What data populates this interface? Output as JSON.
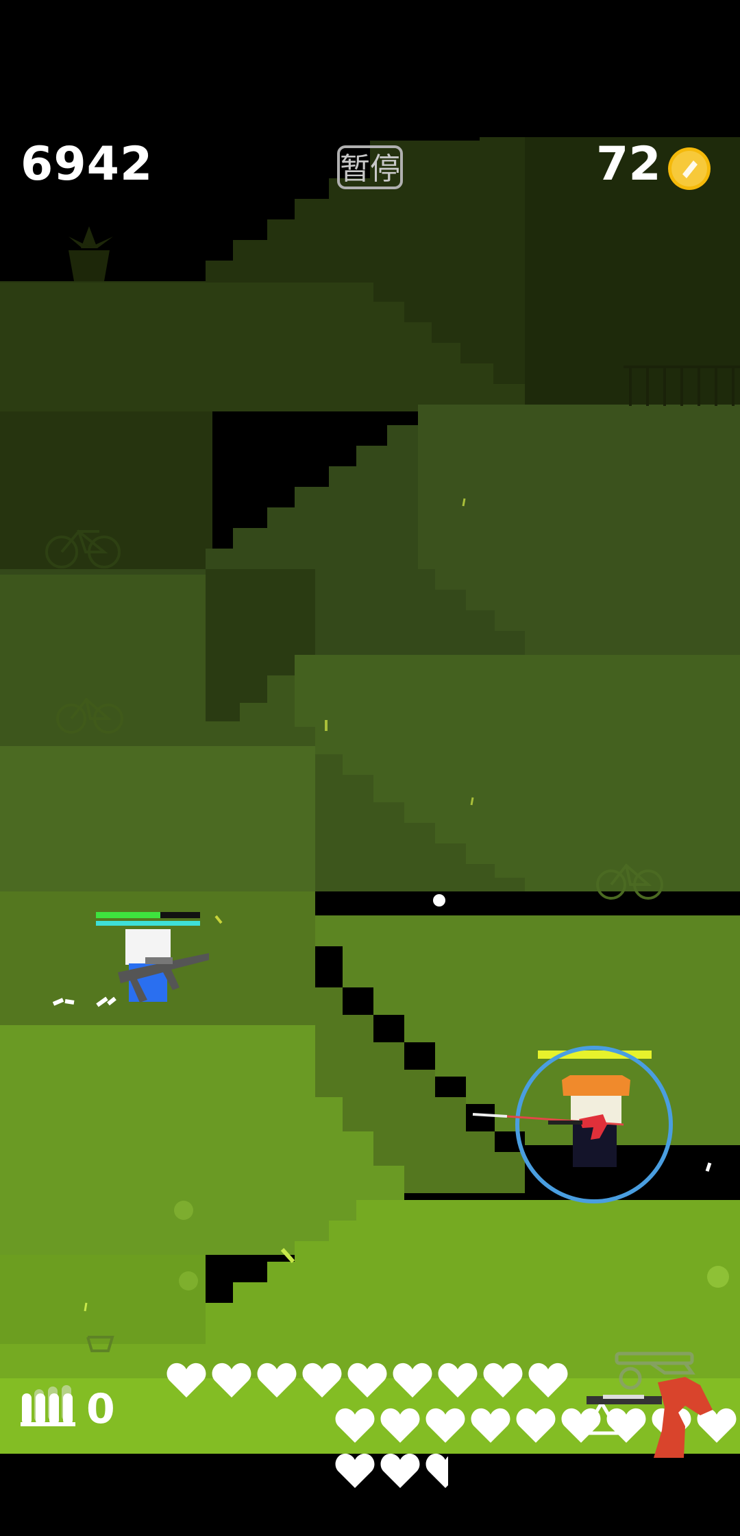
{
  "hud": {
    "score": "6942",
    "pause_label": "暂停",
    "coins": "72",
    "ammo": "0",
    "hearts_full": 20,
    "hearts_half": 1
  },
  "colors": {
    "sky": "#000000",
    "coin": "#f5b90a",
    "player_health": "#3ee33e",
    "player_shield": "#3ee0d8",
    "enemy_health": "#e7f22c",
    "shield_ring": "#4a9ee0",
    "enemy_hat": "#f08a2c",
    "weapon_red": "#d9442c"
  },
  "icons": {
    "coin": "coin-icon",
    "ammo": "bullets-icon",
    "hearts": "heart-icon",
    "jump": "triangle-up-icon",
    "weapon": "revolver-icon"
  },
  "player": {
    "health_fraction": 0.62,
    "shield_fraction": 1.0
  },
  "enemy": {
    "health_fraction": 1.0
  }
}
